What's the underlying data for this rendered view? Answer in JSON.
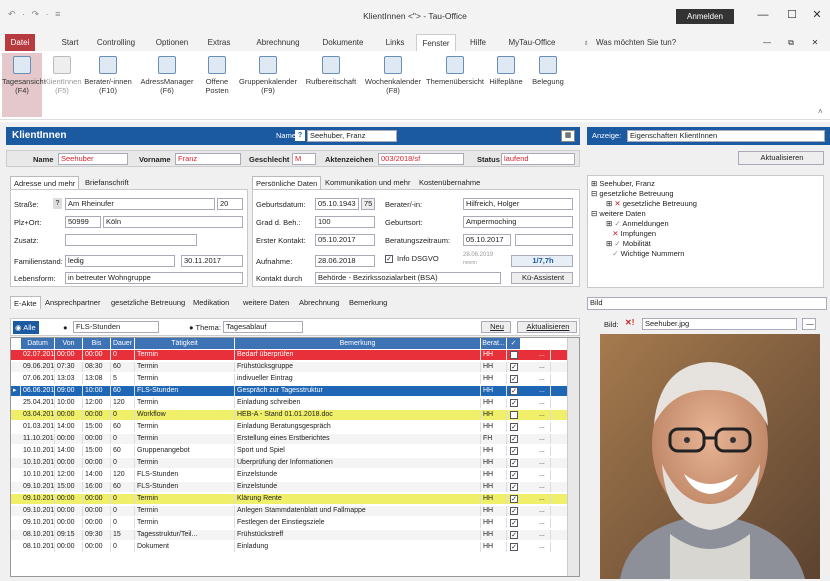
{
  "window": {
    "quick_access": "↶ · ↷ · ≡",
    "title": "KlientInnen <\"> - Tau-Office",
    "login_label": "Anmelden"
  },
  "tabs": [
    {
      "label": "Datei"
    },
    {
      "label": "Start"
    },
    {
      "label": "Controlling"
    },
    {
      "label": "Optionen"
    },
    {
      "label": "Extras"
    },
    {
      "label": "Abrechnung"
    },
    {
      "label": "Dokumente"
    },
    {
      "label": "Links"
    },
    {
      "label": "Fenster"
    },
    {
      "label": "Hilfe"
    },
    {
      "label": "MyTau-Office"
    }
  ],
  "tell_me": "Was möchten Sie tun?",
  "ribbon": [
    {
      "l1": "Tagesansicht",
      "l2": "(F4)"
    },
    {
      "l1": "KlientInnen",
      "l2": "(F5)"
    },
    {
      "l1": "Berater/-innen",
      "l2": "(F10)"
    },
    {
      "l1": "AdressManager",
      "l2": "(F6)"
    },
    {
      "l1": "Offene",
      "l2": "Posten"
    },
    {
      "l1": "Gruppenkalender",
      "l2": "(F9)"
    },
    {
      "l1": "Rufbereitschaft",
      "l2": ""
    },
    {
      "l1": "Wochenkalender",
      "l2": "(F8)"
    },
    {
      "l1": "Themenübersicht",
      "l2": ""
    },
    {
      "l1": "Hilfepläne",
      "l2": ""
    },
    {
      "l1": "Belegung",
      "l2": ""
    }
  ],
  "header": {
    "title": "KlientInnen",
    "name_label": "Name",
    "name_value": "Seehuber, Franz",
    "show_label": "Anzeige:",
    "show_value": "Eigenschaften KlientInnen",
    "refresh": "Aktualisieren"
  },
  "client": {
    "name_label": "Name",
    "name": "Seehuber",
    "vorname_label": "Vorname",
    "vorname": "Franz",
    "geschlecht_label": "Geschlecht",
    "geschlecht": "M",
    "akten_label": "Aktenzeichen",
    "akten": "003/2018/sf",
    "status_label": "Status",
    "status": "laufend"
  },
  "subtabs_left": [
    "Adresse und mehr",
    "Briefanschrift"
  ],
  "subtabs_mid": [
    "Persönliche Daten",
    "Kommunikation und mehr",
    "Kostenübernahme"
  ],
  "address": {
    "strasse_label": "Straße:",
    "strasse": "Am Rheinufer",
    "hausnr": "20",
    "plz_label": "Plz+Ort:",
    "plz": "50999",
    "ort": "Köln",
    "zusatz_label": "Zusatz:",
    "fam_label": "Familienstand:",
    "fam": "ledig",
    "fam_date": "30.11.2017",
    "leben_label": "Lebensform:",
    "leben": "in betreuter Wohngruppe"
  },
  "personal": {
    "geb_label": "Geburtsdatum:",
    "geb": "05.10.1943",
    "alter": "75",
    "grad_label": "Grad d. Beh.:",
    "grad": "100",
    "erst_label": "Erster Kontakt:",
    "erst": "05.10.2017",
    "aufn_label": "Aufnahme:",
    "aufn": "28.06.2018",
    "kontakt_label": "Kontakt durch",
    "kontakt": "Behörde - Bezirkssozialarbeit (BSA)",
    "berater_label": "Berater/-in:",
    "berater": "Hilfreich, Holger",
    "gebort_label": "Geburtsort:",
    "gebort": "Ampermoching",
    "zeitraum_label": "Beratungszeitraum:",
    "zeitraum": "05.10.2017",
    "dsgvo": "Info DSGVO",
    "dsgvo_date": "28.06.2019",
    "dsgvo_sub": "nnnnn",
    "ratio": "1/7,7h",
    "assist": "Kü-Assistent"
  },
  "tree": {
    "root": "Seehuber, Franz",
    "items": [
      "gesetzliche Betreuung",
      "gesetzliche Betreuung",
      "weitere Daten",
      "Anmeldungen",
      "Impfungen",
      "Mobilität",
      "Wichtige Nummern"
    ]
  },
  "akte_tabs": [
    "E-Akte",
    "Ansprechpartner",
    "gesetzliche Betreuung",
    "Medikation",
    "weitere Daten",
    "Abrechnung",
    "Bemerkung"
  ],
  "filter": {
    "alle": "Alle",
    "fls": "FLS-Stunden",
    "thema_label": "Thema:",
    "thema": "Tagesablauf",
    "neu": "Neu",
    "akt": "Aktualisieren"
  },
  "columns": [
    "Datum",
    "Von",
    "Bis",
    "Dauer",
    "Tätigkeit",
    "Bemerkung",
    "Berat...",
    "✓"
  ],
  "rows": [
    [
      "02.07.2019",
      "00:00",
      "00:00",
      "0",
      "Termin",
      "Bedarf überprüfen",
      "HH",
      false,
      "red"
    ],
    [
      "09.06.2019",
      "07:30",
      "08:30",
      "60",
      "Termin",
      "Frühstücksgruppe",
      "HH",
      true,
      ""
    ],
    [
      "07.06.2019",
      "13:03",
      "13:08",
      "5",
      "Termin",
      "indivueller Eintrag",
      "HH",
      true,
      ""
    ],
    [
      "06.06.2019",
      "09:00",
      "10:00",
      "60",
      "FLS-Stunden",
      "Gespräch zur Tagesstruktur",
      "HH",
      true,
      "sel"
    ],
    [
      "25.04.2019",
      "10:00",
      "12:00",
      "120",
      "Termin",
      "Einladung schreiben",
      "HH",
      true,
      ""
    ],
    [
      "03.04.2019",
      "00:00",
      "00:00",
      "0",
      "Workflow",
      "HEB-A - Stand 01.01.2018.doc",
      "HH",
      false,
      "yellow"
    ],
    [
      "01.03.2019",
      "14:00",
      "15:00",
      "60",
      "Termin",
      "Einladung Beratungsgespräch",
      "HH",
      true,
      ""
    ],
    [
      "11.10.2018",
      "00:00",
      "00:00",
      "0",
      "Termin",
      "Erstellung eines Erstberichtes",
      "FH",
      true,
      ""
    ],
    [
      "10.10.2018",
      "14:00",
      "15:00",
      "60",
      "Gruppenangebot",
      "Sport und Spiel",
      "HH",
      true,
      ""
    ],
    [
      "10.10.2018",
      "00:00",
      "00:00",
      "0",
      "Termin",
      "Überprüfung der Informationen",
      "HH",
      true,
      ""
    ],
    [
      "10.10.2018",
      "12:00",
      "14:00",
      "120",
      "FLS-Stunden",
      "Einzelstunde",
      "HH",
      true,
      ""
    ],
    [
      "09.10.2018",
      "15:00",
      "16:00",
      "60",
      "FLS-Stunden",
      "Einzelstunde",
      "HH",
      true,
      ""
    ],
    [
      "09.10.2018",
      "00:00",
      "00:00",
      "0",
      "Termin",
      "Klärung Rente",
      "HH",
      true,
      "yellow"
    ],
    [
      "09.10.2018",
      "00:00",
      "00:00",
      "0",
      "Termin",
      "Anlegen Stammdatenblatt und Fallmappe",
      "HH",
      true,
      ""
    ],
    [
      "09.10.2018",
      "00:00",
      "00:00",
      "0",
      "Termin",
      "Festlegen der Einstiegsziele",
      "HH",
      true,
      ""
    ],
    [
      "08.10.2018",
      "09:15",
      "09:30",
      "15",
      "Tagesstruktur/Teil...",
      "Frühstückstreff",
      "HH",
      true,
      ""
    ],
    [
      "08.10.2018",
      "00:00",
      "00:00",
      "0",
      "Dokument",
      "Einladung",
      "HH",
      true,
      ""
    ]
  ],
  "bild": {
    "label": "Bild",
    "file_label": "Bild:",
    "file": "Seehuber.jpg"
  },
  "colors": {
    "accent": "#1b5aa0",
    "row_red": "#e8303a",
    "row_yellow": "#f0ef6a",
    "row_sel": "#1f66b5"
  }
}
